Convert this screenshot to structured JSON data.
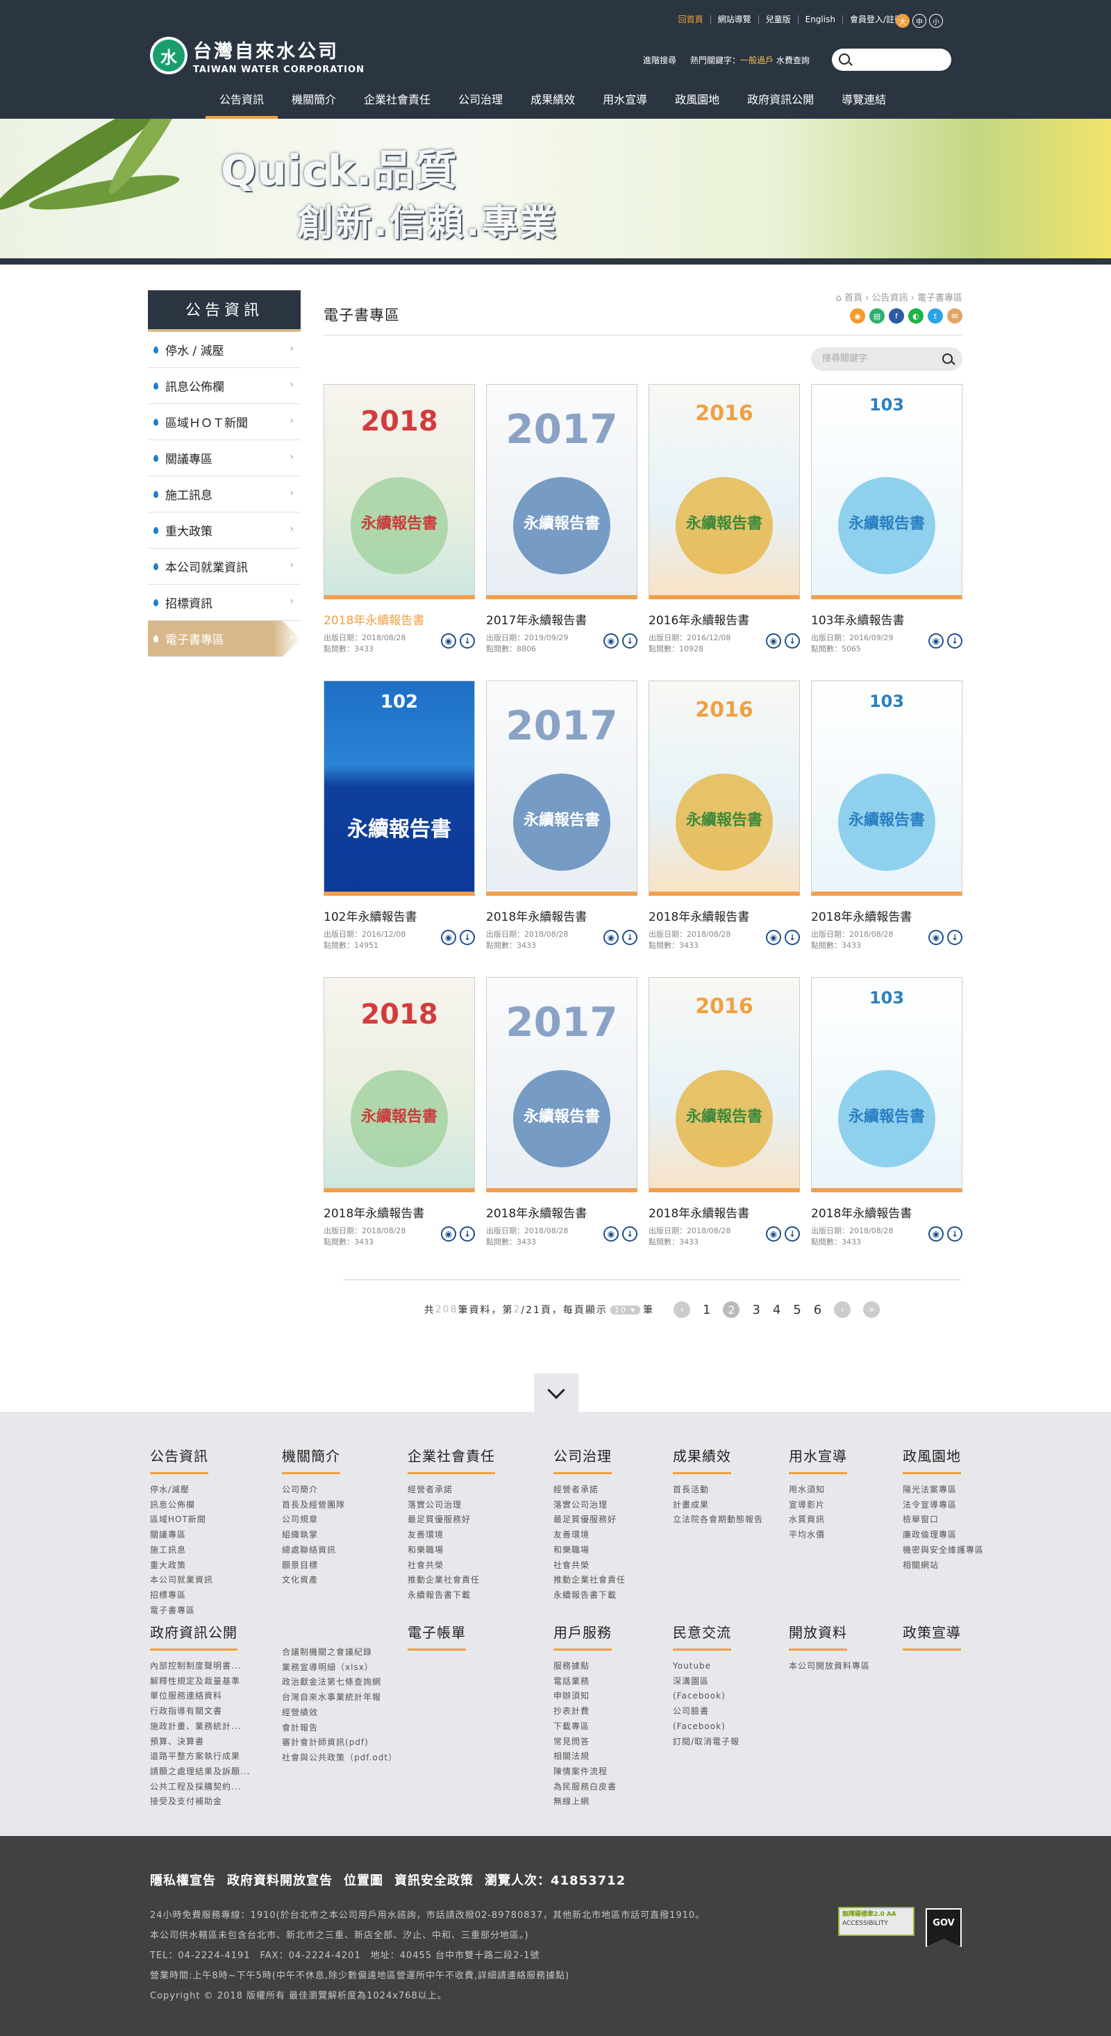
{
  "header": {
    "top_links": [
      "回首頁",
      "網站導覽",
      "兒童版",
      "English",
      "會員登入/註冊"
    ],
    "font_sizes": [
      "大",
      "中",
      "小"
    ],
    "logo_zh": "台灣自來水公司",
    "logo_en": "TAIWAN WATER CORPORATION",
    "logo_mark": "水",
    "advanced_search": "進階搜尋",
    "hot_label": "熱門關鍵字：",
    "hot_keyword_1": "一般過戶",
    "hot_keyword_2": "水費查詢",
    "main_nav": [
      "公告資訊",
      "機關簡介",
      "企業社會責任",
      "公司治理",
      "成果績效",
      "用水宣導",
      "政風園地",
      "政府資訊公開",
      "導覽連結"
    ]
  },
  "banner": {
    "line1": "Quick.品質",
    "line2": "創新.信賴.專業"
  },
  "sidebar": {
    "title": "公告資訊",
    "items": [
      "停水 / 減壓",
      "訊息公佈欄",
      "區域ＨＯＴ新聞",
      "關議專區",
      "施工訊息",
      "重大政策",
      "本公司就業資訊",
      "招標資訊",
      "電子書專區"
    ]
  },
  "content": {
    "breadcrumb": "首頁 › 公告資訊 › 電子書專區",
    "title": "電子書專區",
    "search_placeholder": "搜尋關鍵字",
    "share_icons": [
      "rss-icon",
      "print-icon",
      "facebook-icon",
      "line-icon",
      "twitter-icon",
      "email-icon"
    ],
    "books": [
      {
        "title": "2018年永續報告書",
        "date": "出版日期：2018/08/28",
        "views": "點閱數：3433",
        "cover": "2018"
      },
      {
        "title": "2017年永續報告書",
        "date": "出版日期：2019/09/29",
        "views": "點閱數：8806",
        "cover": "2017"
      },
      {
        "title": "2016年永續報告書",
        "date": "出版日期：2016/12/08",
        "views": "點閱數：10928",
        "cover": "2016"
      },
      {
        "title": "103年永續報告書",
        "date": "出版日期：2016/09/29",
        "views": "點閱數：5065",
        "cover": "103"
      },
      {
        "title": "102年永續報告書",
        "date": "出版日期：2016/12/08",
        "views": "點閱數：14951",
        "cover": "102"
      },
      {
        "title": "2018年永續報告書",
        "date": "出版日期：2018/08/28",
        "views": "點閱數：3433",
        "cover": "2017"
      },
      {
        "title": "2018年永續報告書",
        "date": "出版日期：2018/08/28",
        "views": "點閱數：3433",
        "cover": "2016"
      },
      {
        "title": "2018年永續報告書",
        "date": "出版日期：2018/08/28",
        "views": "點閱數：3433",
        "cover": "103"
      },
      {
        "title": "2018年永續報告書",
        "date": "出版日期：2018/08/28",
        "views": "點閱數：3433",
        "cover": "2018"
      },
      {
        "title": "2018年永續報告書",
        "date": "出版日期：2018/08/28",
        "views": "點閱數：3433",
        "cover": "2017"
      },
      {
        "title": "2018年永續報告書",
        "date": "出版日期：2018/08/28",
        "views": "點閱數：3433",
        "cover": "2016"
      },
      {
        "title": "2018年永續報告書",
        "date": "出版日期：2018/08/28",
        "views": "點閱數：3433",
        "cover": "103"
      }
    ]
  },
  "pager": {
    "total_prefix": "共",
    "total": "208",
    "total_suffix": "筆資料，第",
    "page": "2",
    "page_suffix": "/21頁，每頁顯示",
    "per_page": "10",
    "per_page_suffix": "筆",
    "pages": [
      "1",
      "2",
      "3",
      "4",
      "5",
      "6"
    ],
    "prev": "‹",
    "next": "›",
    "last": "»"
  },
  "footer_cols": [
    {
      "title": "公告資訊",
      "items": [
        "停水/減壓",
        "訊息公佈欄",
        "區域HOT新聞",
        "關議專區",
        "施工訊息",
        "重大政策",
        "本公司就業資訊",
        "招標專區",
        "電子書專區"
      ]
    },
    {
      "title": "機關簡介",
      "items": [
        "公司簡介",
        "首長及經營團隊",
        "公司規章",
        "組織執掌",
        "總處聯絡資訊",
        "願景目標",
        "文化資產"
      ]
    },
    {
      "title": "企業社會責任",
      "items": [
        "經營者承諾",
        "落實公司治理",
        "最足質優服務好",
        "友善環境",
        "和樂職場",
        "社會共榮",
        "推動企業社會責任",
        "永續報告書下載"
      ]
    },
    {
      "title": "公司治理",
      "items": [
        "經營者承諾",
        "落實公司治理",
        "最足質優服務好",
        "友善環境",
        "和樂職場",
        "社會共榮",
        "推動企業社會責任",
        "永續報告書下載"
      ]
    },
    {
      "title": "成果績效",
      "items": [
        "首長活動",
        "計畫成果",
        "立法院各會期動態報告"
      ]
    },
    {
      "title": "用水宣導",
      "items": [
        "用水須知",
        "宣導影片",
        "水質資訊",
        "平均水價"
      ]
    },
    {
      "title": "政風園地",
      "items": [
        "陽光法案專區",
        "法令宣導專區",
        "檢舉窗口",
        "廉政倫理專區",
        "機密與安全維護專區",
        "相關網站"
      ]
    },
    {
      "title": "政府資訊公開",
      "items": [
        "內部控制制度聲明書...",
        "解釋性規定及裁量基準",
        "單位服務連絡資料",
        "行政指導有關文書",
        "施政計畫、業務統計...",
        "預算、決算書",
        "道路平整方案執行成果",
        "請願之處理結果及訴願...",
        "公共工程及採購契約...",
        "接受及支付補助金"
      ]
    },
    {
      "title": "",
      "items": [
        "合議制機關之會議紀錄",
        "業務宣導明細（xlsx）",
        "政治獻金法第七條查詢網",
        "台灣自來水事業統計年報",
        "經營績效",
        "會計報告",
        "審計會計師資訊(pdf)",
        "社會與公共政策（pdf.odt）"
      ]
    },
    {
      "title": "電子帳單",
      "items": []
    },
    {
      "title": "用戶服務",
      "items": [
        "服務據點",
        "電話業務",
        "申辦須知",
        "抄表計費",
        "下載專區",
        "常見問答",
        "相關法規",
        "陳情案件流程",
        "為民服務白皮書",
        "無線上網"
      ]
    },
    {
      "title": "民意交流",
      "items": [
        "Youtube",
        "深溝園區",
        "(Facebook)",
        "公司臉書",
        "(Facebook)",
        "訂閱/取消電子報"
      ]
    },
    {
      "title": "開放資料",
      "items": [
        "本公司開放資料專區"
      ]
    },
    {
      "title": "政策宣導",
      "items": []
    }
  ],
  "bottom": {
    "links": [
      "隱私權宣告",
      "政府資料開放宣告",
      "位置圖",
      "資訊安全政策",
      "瀏覽人次：41853712"
    ],
    "lines": [
      "24小時免費服務專線：1910(於台北市之本公司用戶用水諮詢，市話請改撥02-89780837，其他新北市地區市話可直撥1910。",
      "本公司供水轄區未包含台北市、新北市之三重、新店全部、汐止、中和、三重部分地區。)",
      "TEL：04-2224-4191　FAX：04-2224-4201　地址：40455 台中市雙十路二段2-1號",
      "營業時間:上午8時~下午5時(中午不休息,除少數偏遠地區營運所中午不收費,詳細請連絡服務據點)",
      "Copyright © 2018 版權所有 最佳瀏覽解析度為1024x768以上。"
    ],
    "badge1_title": "無障礙標章2.0",
    "badge1_text": "ACCESSIBILITY",
    "badge1_grade": "AA",
    "badge2": "GOV"
  },
  "colors": {
    "header_bg": "#2b3541",
    "accent": "#f0a040",
    "footer_bg": "#e7e8eb",
    "bottom_bg": "#3f4142",
    "icon_blue": "#1e4f8a"
  }
}
